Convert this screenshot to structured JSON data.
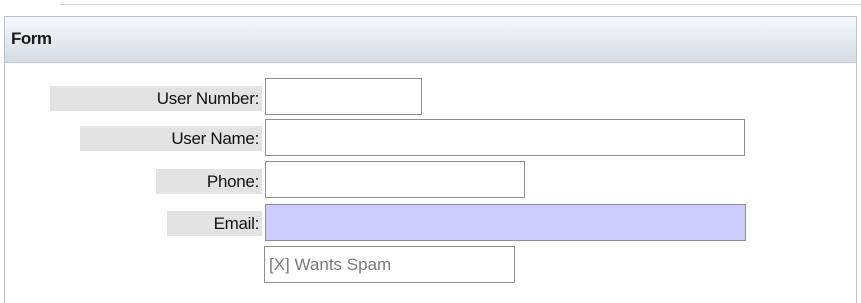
{
  "form": {
    "title": "Form",
    "fields": {
      "user_number": {
        "label": "User Number:",
        "value": ""
      },
      "user_name": {
        "label": "User Name:",
        "value": ""
      },
      "phone": {
        "label": "Phone:",
        "value": ""
      },
      "email": {
        "label": "Email:",
        "value": "",
        "highlight_color": "#ccccff"
      }
    },
    "wants_spam": {
      "label": "[X] Wants Spam"
    }
  }
}
